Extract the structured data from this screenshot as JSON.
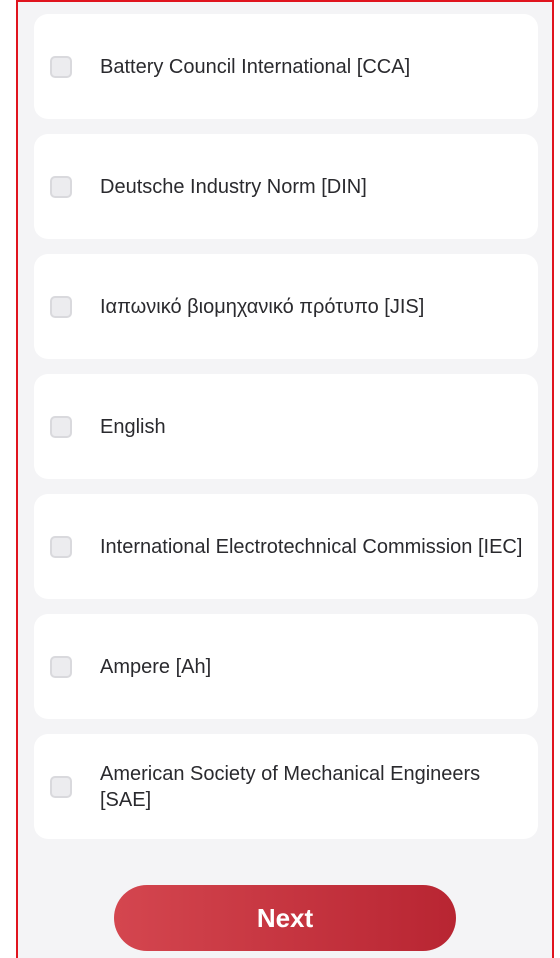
{
  "options": [
    {
      "label": "Battery Council International [CCA]",
      "checked": false
    },
    {
      "label": "Deutsche Industry Norm [DIN]",
      "checked": false
    },
    {
      "label": "Ιαπωνικό βιομηχανικό πρότυπο [JIS]",
      "checked": false
    },
    {
      "label": "English",
      "checked": false
    },
    {
      "label": "International Electrotechnical Commission [IEC]",
      "checked": false
    },
    {
      "label": "Ampere [Ah]",
      "checked": false
    },
    {
      "label": "American Society of Mechanical Engineers [SAE]",
      "checked": false
    }
  ],
  "next_button": {
    "label": "Next"
  },
  "colors": {
    "frame_border": "#e0141e",
    "button_start": "#d4464f",
    "button_end": "#b82532",
    "card": "#ffffff",
    "background": "#f4f4f6"
  }
}
